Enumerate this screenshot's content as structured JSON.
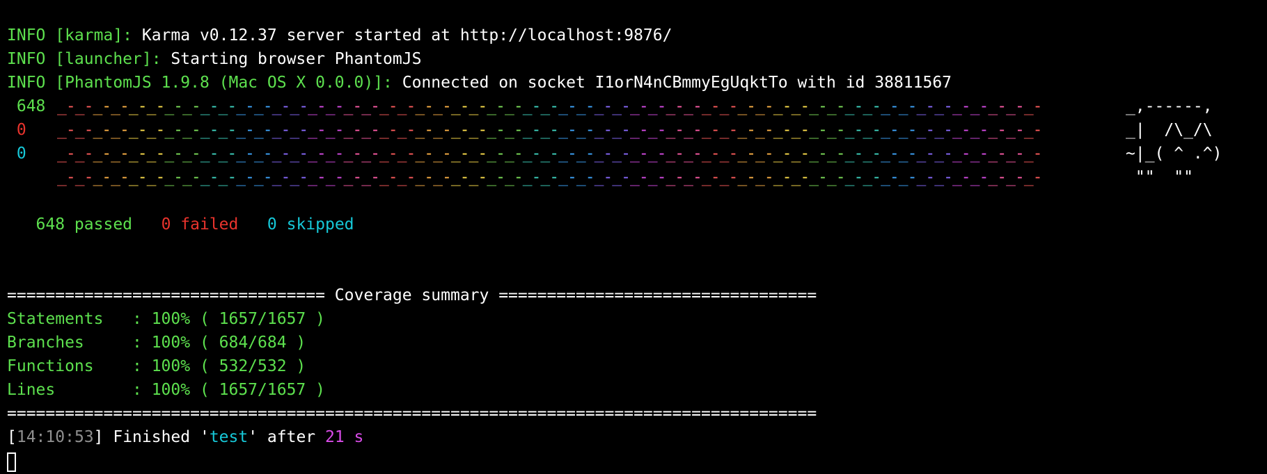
{
  "log": [
    {
      "prefix": "INFO [karma]:",
      "message": " Karma v0.12.37 server started at http://localhost:9876/"
    },
    {
      "prefix": "INFO [launcher]:",
      "message": " Starting browser PhantomJS"
    },
    {
      "prefix": "INFO [PhantomJS 1.9.8 (Mac OS X 0.0.0)]:",
      "message": " Connected on socket I1orN4nCBmmyEgUqktTo with id 38811567"
    }
  ],
  "nyan": {
    "rows": [
      {
        "count": " 648",
        "count_color": "#5de04e",
        "cat": "_,------,"
      },
      {
        "count": " 0",
        "count_color": "#e8332c",
        "cat": "_|  /\\_/\\"
      },
      {
        "count": " 0",
        "count_color": "#16c8d8",
        "cat": "~|_( ^ .^)"
      },
      {
        "count": "",
        "count_color": "#ffffff",
        "cat": " \"\"  \"\""
      }
    ],
    "trail_colors": [
      "#ff5c5c",
      "#ffb347",
      "#ffe14d",
      "#7ee05a",
      "#3fd6c2",
      "#3fa7ff",
      "#8a6bff",
      "#d94ce8",
      "#ff5ca8"
    ]
  },
  "summary": {
    "passed": "648 passed",
    "failed": "0 failed",
    "skipped": "0 skipped"
  },
  "coverage": {
    "header": "================================= Coverage summary =================================",
    "rows": [
      {
        "label": "Statements   : 100% ( 1657/1657 )"
      },
      {
        "label": "Branches     : 100% ( 684/684 )"
      },
      {
        "label": "Functions    : 100% ( 532/532 )"
      },
      {
        "label": "Lines        : 100% ( 1657/1657 )"
      }
    ],
    "footer": "===================================================================================="
  },
  "finished": {
    "bracket_open": "[",
    "time": "14:10:53",
    "bracket_close": "]",
    "text1": " Finished '",
    "task": "test",
    "text2": "' after ",
    "duration": "21 s"
  }
}
